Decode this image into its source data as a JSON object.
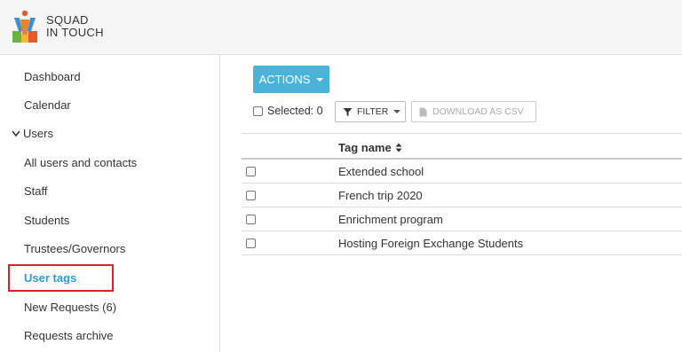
{
  "brand": {
    "line1": "SQUAD",
    "line2": "IN TOUCH"
  },
  "sidebar": {
    "items": [
      {
        "label": "Dashboard"
      },
      {
        "label": "Calendar"
      },
      {
        "label": "Users",
        "expanded": true
      },
      {
        "label": "All users and contacts"
      },
      {
        "label": "Staff"
      },
      {
        "label": "Students"
      },
      {
        "label": "Trustees/Governors"
      },
      {
        "label": "User tags",
        "active": true
      },
      {
        "label": "New Requests (6)"
      },
      {
        "label": "Requests archive"
      }
    ]
  },
  "toolbar": {
    "actions_label": "ACTIONS",
    "selected_label": "Selected: 0",
    "filter_label": "FILTER",
    "download_label": "DOWNLOAD AS CSV"
  },
  "table": {
    "header": "Tag name",
    "rows": [
      {
        "name": "Extended school"
      },
      {
        "name": "French trip 2020"
      },
      {
        "name": "Enrichment program"
      },
      {
        "name": "Hosting Foreign Exchange Students"
      }
    ]
  },
  "colors": {
    "accent": "#4bb3d8",
    "active_link": "#2e9ad0",
    "highlight": "#e02020"
  },
  "icons": [
    "squad-logo-icon",
    "chevron-down-icon",
    "caret-down-icon",
    "filter-icon",
    "file-icon",
    "sort-icon"
  ]
}
